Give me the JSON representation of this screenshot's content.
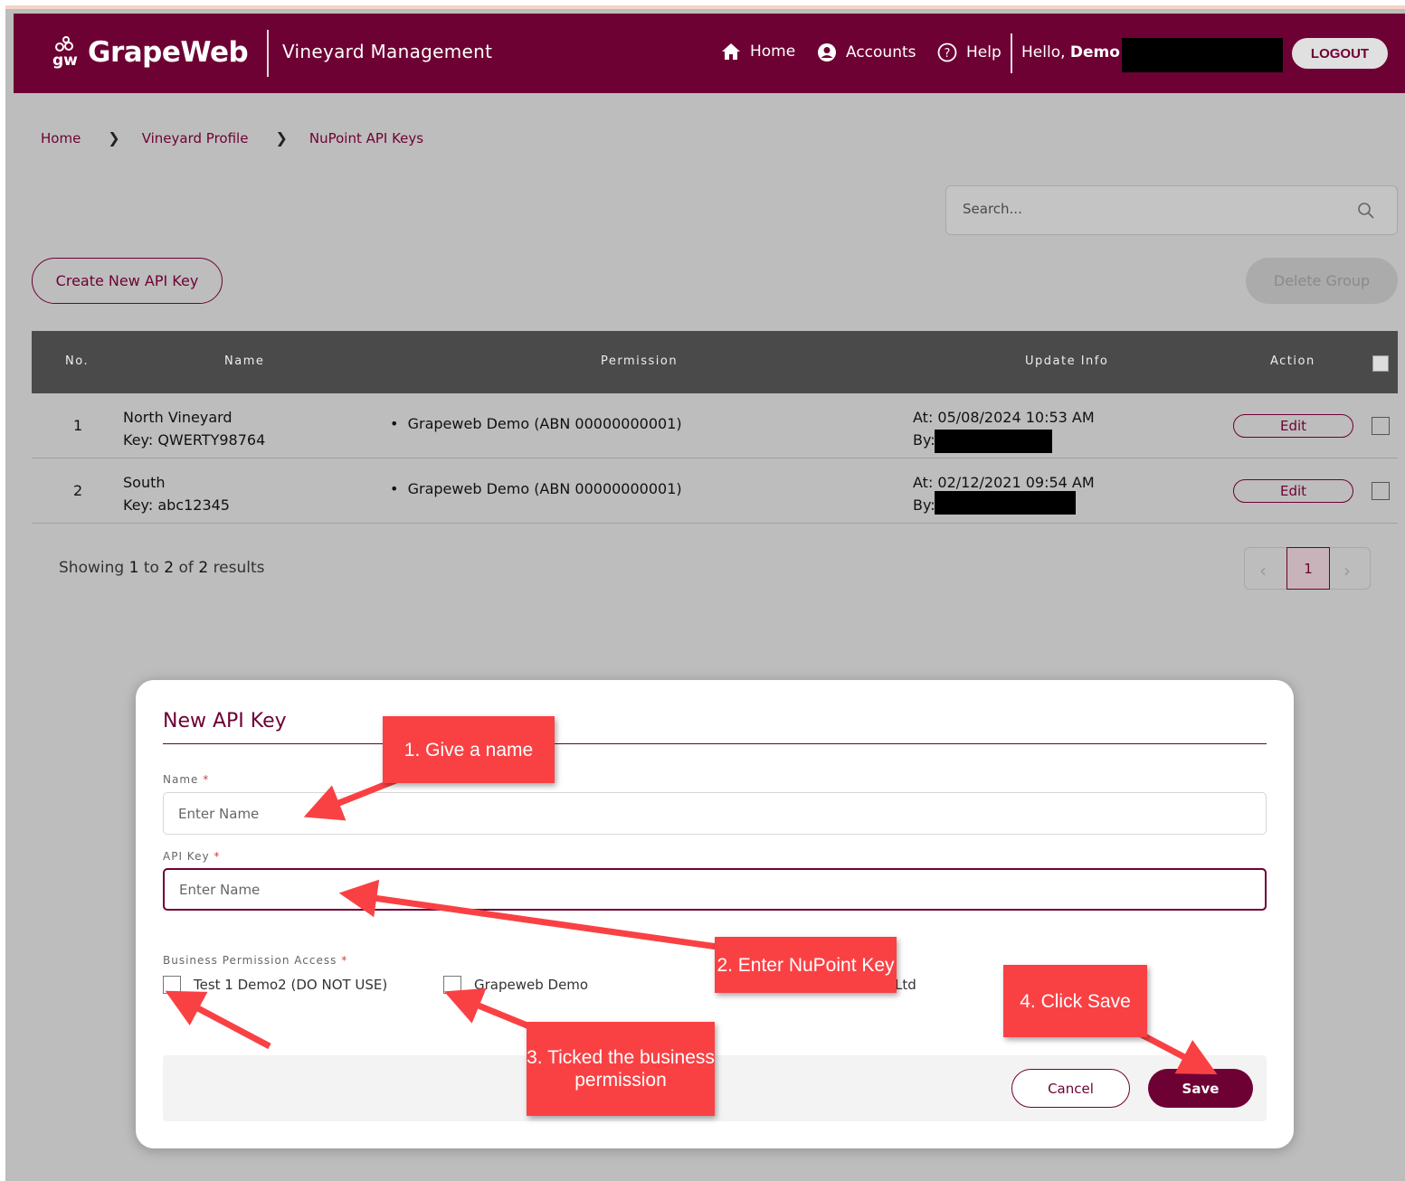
{
  "header": {
    "brand": "GrapeWeb",
    "app_title": "Vineyard Management",
    "nav": {
      "home": "Home",
      "accounts": "Accounts",
      "help": "Help"
    },
    "hello_prefix": "Hello,",
    "hello_name": "Demo V",
    "logout": "LOGOUT",
    "color": "#6e0133"
  },
  "breadcrumb": [
    "Home",
    "Vineyard Profile",
    "NuPoint API Keys"
  ],
  "search": {
    "placeholder": "Search..."
  },
  "toolbar": {
    "create": "Create New API Key",
    "delete_group": "Delete Group"
  },
  "table": {
    "columns": [
      "No.",
      "Name",
      "Permission",
      "Update Info",
      "Action"
    ],
    "rows": [
      {
        "no": "1",
        "name": "North Vineyard",
        "key": "Key: QWERTY98764",
        "permission": "Grapeweb Demo (ABN 00000000001)",
        "at": "At: 05/08/2024 10:53 AM",
        "by": "By:",
        "action": "Edit"
      },
      {
        "no": "2",
        "name": "South",
        "key": "Key: abc12345",
        "permission": "Grapeweb Demo (ABN 00000000001)",
        "at": "At: 02/12/2021 09:54 AM",
        "by": "By:",
        "action": "Edit"
      }
    ]
  },
  "pagination": {
    "showing_prefix": "Showing",
    "from": "1",
    "to_word": "to",
    "to": "2",
    "of_word": "of",
    "total": "2",
    "results_word": "results",
    "current_page": "1"
  },
  "modal": {
    "title": "New API Key",
    "name_label": "Name",
    "name_placeholder": "Enter Name",
    "apikey_label": "API Key",
    "apikey_placeholder": "Enter Name",
    "perm_label": "Business Permission Access",
    "required_mark": "*",
    "permissions": [
      "Test 1 Demo2 (DO NOT USE)",
      "Grapeweb Demo",
      "Ltd"
    ],
    "cancel": "Cancel",
    "save": "Save"
  },
  "annotations": {
    "step1": "1. Give a name",
    "step2": "2. Enter NuPoint Key",
    "step3": "3. Ticked the business permission",
    "step4": "4. Click Save",
    "color": "#f94144"
  }
}
